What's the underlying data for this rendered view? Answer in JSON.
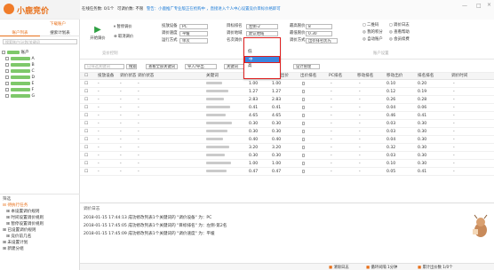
{
  "app": {
    "title": "小鹿竞价"
  },
  "sidebar": {
    "account_button": "下载账户",
    "tabs": [
      "账户列表",
      "搜索计划表"
    ],
    "search_placeholder": "搜索账户/计划/关键词",
    "tree": [
      {
        "label": "账户",
        "level": 0
      },
      {
        "label": "A",
        "level": 1
      },
      {
        "label": "B",
        "level": 1
      },
      {
        "label": "C",
        "level": 1
      },
      {
        "label": "D",
        "level": 1
      },
      {
        "label": "E",
        "level": 1
      },
      {
        "label": "F",
        "level": 1
      },
      {
        "label": "G",
        "level": 1
      }
    ],
    "lower_title": "筛选",
    "lower_items": [
      "待执行任务",
      "本设置调价规则",
      "时间设置调价规则",
      "暂停设置调价规则",
      "已设置调价规则",
      "竞价前几名",
      "未设置计划",
      "新建分组"
    ]
  },
  "header": {
    "version": "在线任务数: 0/1个",
    "notice": "可调价数: 不限",
    "alert": "警告：小鹿推广专业版正在抢购中 ，直接进入个人中心设置竞价目标价格即可"
  },
  "top_form": {
    "start_button": "开始调价",
    "pause_button": "暂停调价",
    "cancel_button": "取消调价",
    "fields": [
      {
        "label": "投放设备",
        "value": "PC"
      },
      {
        "label": "调价速度",
        "value": "平缓"
      },
      {
        "label": "运行方式",
        "value": "单次"
      },
      {
        "label": "目标排名",
        "value": "左侧-2"
      },
      {
        "label": "调价地域",
        "value": "默认地域"
      },
      {
        "label": "名次调价",
        "value": "中"
      },
      {
        "label": "最高限价",
        "value": "8"
      },
      {
        "label": "最低限价",
        "value": "0.30"
      },
      {
        "label": "调价方式",
        "value": "出价排名优先"
      }
    ],
    "section_label": "竞价控制",
    "right_options": [
      "二维码",
      "我的积分",
      "自动账户",
      "调价日志",
      "查看帮助",
      "会员续费"
    ],
    "right_section": "账户设置"
  },
  "toolbar": {
    "filter_placeholder": "已筛选关键词",
    "search_btn": "搜索",
    "filter1": "查看全部关键词",
    "filter2": "导入/导出",
    "filter3": "关键词",
    "filter4": "设计管理"
  },
  "table": {
    "headers": [
      "",
      "投放设备",
      "调价状态",
      "调价状态",
      "",
      "关键词",
      "实际出价",
      "调价后出价",
      "出价排名",
      "PC排名",
      "移动排名",
      "移动出价",
      "排名排名",
      "调价时间"
    ],
    "rows": [
      {
        "bid": "1.00",
        "after": "1.00",
        "v1": "0.10",
        "v2": "0.20"
      },
      {
        "bid": "1.27",
        "after": "1.27",
        "v1": "0.12",
        "v2": "0.19"
      },
      {
        "bid": "2.83",
        "after": "2.83",
        "v1": "0.26",
        "v2": "0.28"
      },
      {
        "bid": "0.41",
        "after": "0.41",
        "v1": "0.04",
        "v2": "0.06"
      },
      {
        "bid": "4.65",
        "after": "4.65",
        "v1": "0.46",
        "v2": "0.41"
      },
      {
        "bid": "0.30",
        "after": "0.30",
        "v1": "0.03",
        "v2": "0.30"
      },
      {
        "bid": "0.30",
        "after": "0.30",
        "v1": "0.03",
        "v2": "0.30"
      },
      {
        "bid": "0.40",
        "after": "0.40",
        "v1": "0.04",
        "v2": "0.30"
      },
      {
        "bid": "3.20",
        "after": "3.20",
        "v1": "0.32",
        "v2": "0.30"
      },
      {
        "bid": "0.30",
        "after": "0.30",
        "v1": "0.03",
        "v2": "0.30"
      },
      {
        "bid": "1.00",
        "after": "1.00",
        "v1": "0.10",
        "v2": "0.30"
      },
      {
        "bid": "0.47",
        "after": "0.47",
        "v1": "0.05",
        "v2": "0.41"
      }
    ]
  },
  "log": {
    "title": "调价日志",
    "entries": [
      "2018-01-15 17:44:13 成功修改列表1个关键词的 \"调价设备\" 为：PC",
      "2018-01-15 17:45:05 成功修改列表1个关键词的 \"目标排名\" 为：左侧-第2名",
      "2018-01-15 17:45:09 成功修改列表1个关键词的 \"调价速度\" 为：平缓"
    ]
  },
  "status": {
    "left": "清除日志",
    "mid": "循环间隔 1分钟",
    "right": "累计出价数 1/0个"
  },
  "dropdown": {
    "items": [
      "低",
      "中",
      "高"
    ],
    "selected": "中"
  }
}
